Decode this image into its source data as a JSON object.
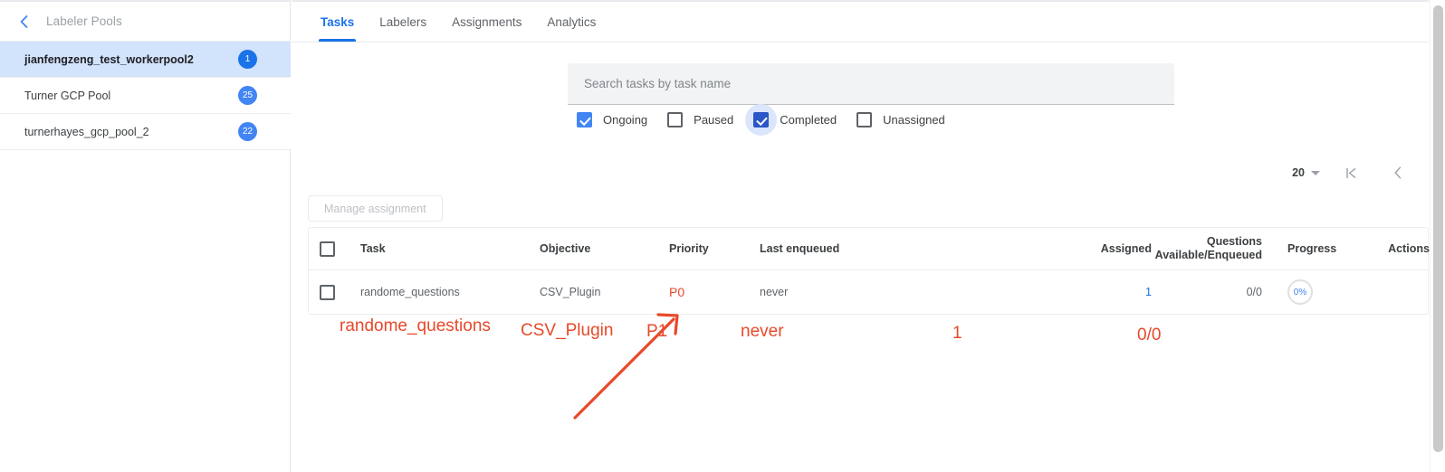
{
  "sidebar": {
    "back_icon": "chevron-left-icon",
    "title": "Labeler Pools",
    "pools": [
      {
        "name": "jianfengzeng_test_workerpool2",
        "count": "1",
        "selected": true
      },
      {
        "name": "Turner GCP Pool",
        "count": "25",
        "selected": false
      },
      {
        "name": "turnerhayes_gcp_pool_2",
        "count": "22",
        "selected": false
      }
    ]
  },
  "tabs": [
    {
      "label": "Tasks",
      "active": true
    },
    {
      "label": "Labelers",
      "active": false
    },
    {
      "label": "Assignments",
      "active": false
    },
    {
      "label": "Analytics",
      "active": false
    }
  ],
  "search": {
    "placeholder": "Search tasks by task name",
    "value": ""
  },
  "filters": [
    {
      "label": "Ongoing",
      "checked": true,
      "focused": false
    },
    {
      "label": "Paused",
      "checked": false,
      "focused": false
    },
    {
      "label": "Completed",
      "checked": true,
      "focused": true
    },
    {
      "label": "Unassigned",
      "checked": false,
      "focused": false
    }
  ],
  "pagination": {
    "page_size": "20",
    "first_page_icon": "first-page-icon",
    "first_page_glyph": "|◁",
    "prev_page_icon": "chevron-left-icon",
    "prev_page_glyph": "‹"
  },
  "toolbar": {
    "manage_assignment_label": "Manage assignment"
  },
  "table": {
    "columns": {
      "task": "Task",
      "objective": "Objective",
      "priority": "Priority",
      "last_enqueued": "Last enqueued",
      "assigned": "Assigned",
      "questions_line1": "Questions",
      "questions_line2": "Available/Enqueued",
      "progress": "Progress",
      "actions": "Actions"
    },
    "rows": [
      {
        "task": "randome_questions",
        "objective": "CSV_Plugin",
        "priority": "P0",
        "last_enqueued": "never",
        "assigned": "1",
        "questions": "0/0",
        "progress": "0%",
        "actions": ""
      }
    ]
  },
  "annotation": {
    "color": "#e8492a",
    "task": "randome_questions",
    "objective": "CSV_Plugin",
    "priority": "P1",
    "last_enqueued": "never",
    "assigned": "1",
    "questions": "0/0",
    "arrow_label": "arrow-pointing-to-priority"
  },
  "scrollbar": {
    "orientation": "vertical"
  }
}
